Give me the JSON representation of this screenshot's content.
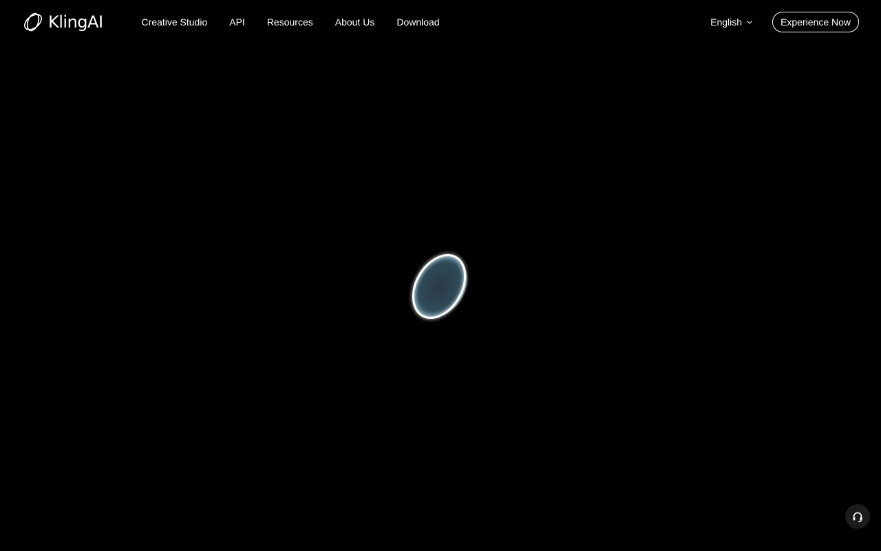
{
  "brand": {
    "logo_text": "KlingAI"
  },
  "nav": {
    "items": [
      {
        "label": "Creative Studio"
      },
      {
        "label": "API"
      },
      {
        "label": "Resources"
      },
      {
        "label": "About Us"
      },
      {
        "label": "Download"
      }
    ]
  },
  "language": {
    "selected": "English"
  },
  "cta": {
    "label": "Experience Now"
  },
  "icons": {
    "logo": "kling-logo-icon",
    "language_dropdown": "chevron-down-icon",
    "support": "headset-icon",
    "loader": "loading-ring-icon"
  },
  "colors": {
    "background": "#000000",
    "text": "#ffffff",
    "support_button_bg": "#1c1c1e",
    "loader_glow": "#9fc3d6"
  }
}
